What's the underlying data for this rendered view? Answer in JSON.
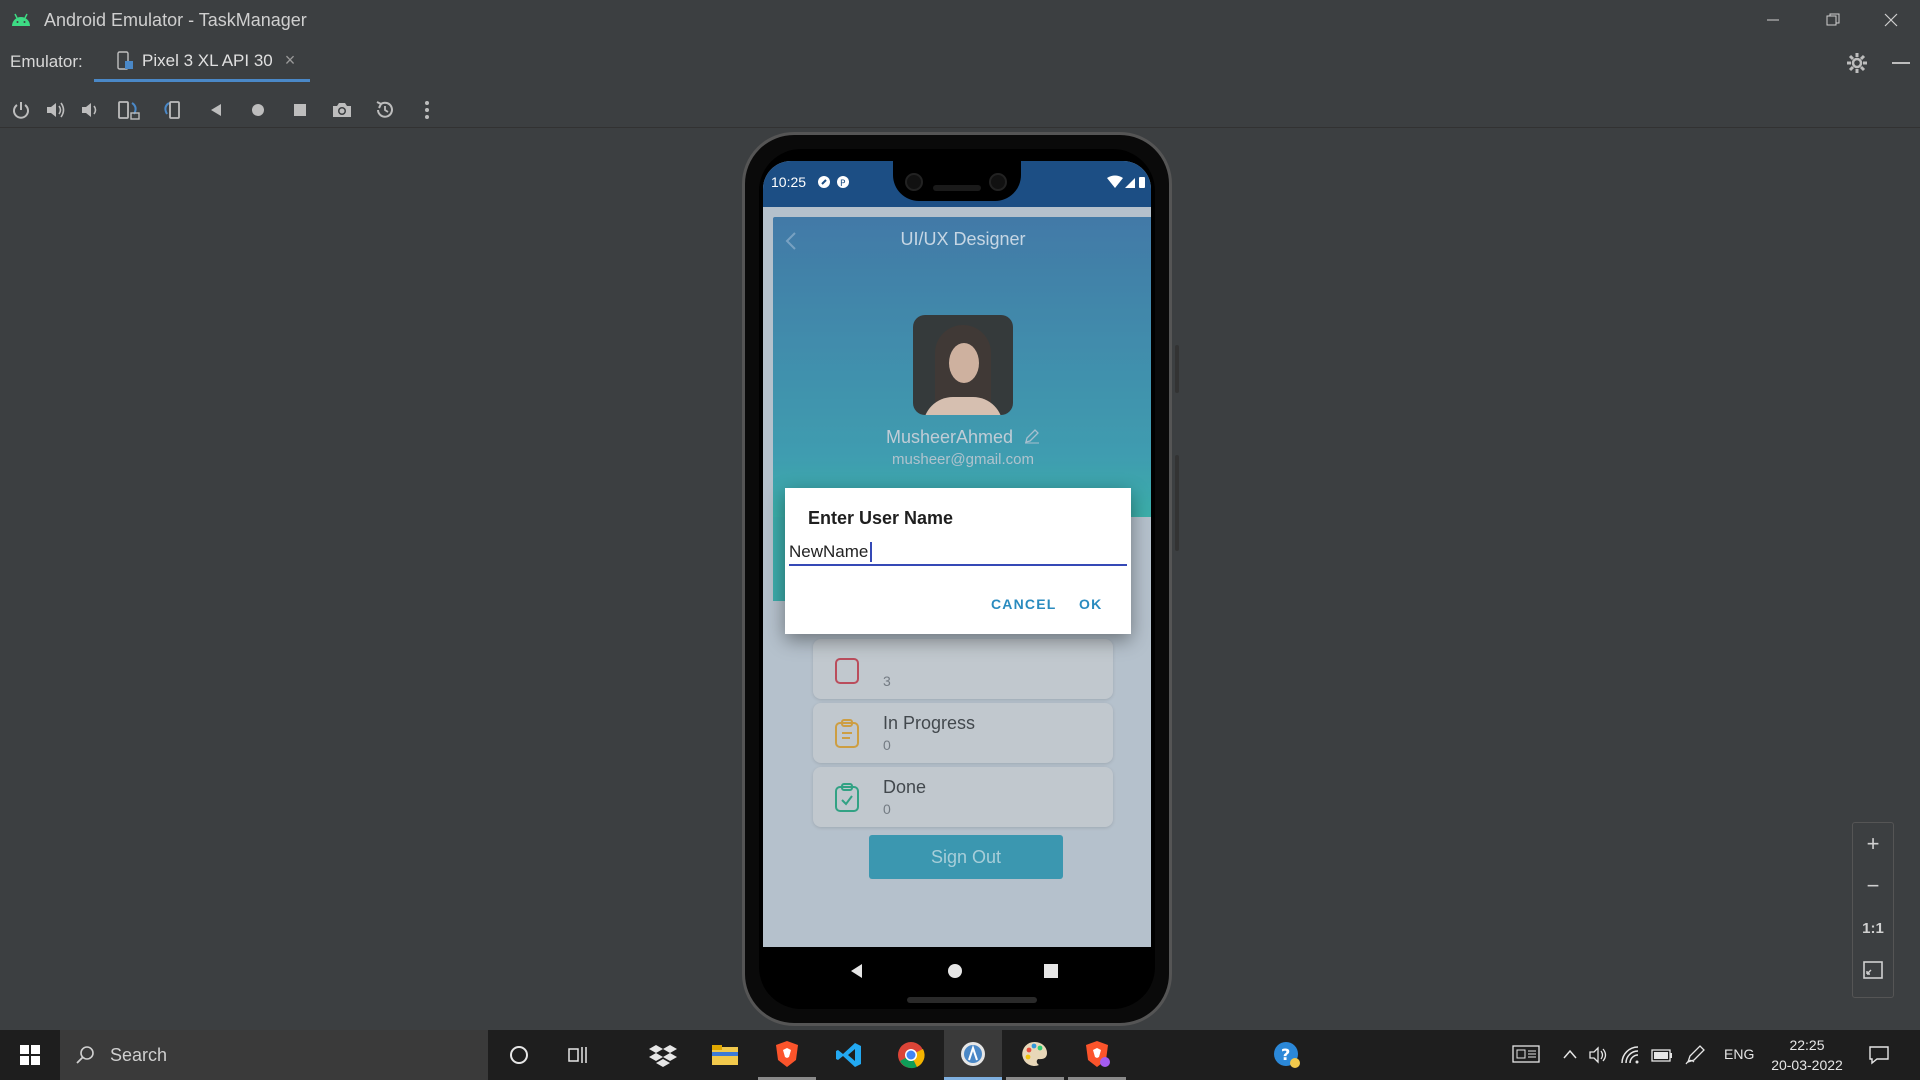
{
  "window": {
    "title": "Android Emulator - TaskManager",
    "controls": [
      "minimize",
      "restore",
      "close"
    ]
  },
  "emulator": {
    "label": "Emulator:",
    "device_tab": "Pixel 3 XL API 30",
    "tab_close": "×"
  },
  "toolbar": {
    "buttons": [
      "power-icon",
      "volume-up-icon",
      "volume-down-icon",
      "rotate-left-icon",
      "rotate-right-icon",
      "back-icon",
      "home-icon",
      "overview-icon",
      "camera-icon",
      "snapshot-icon",
      "more-icon"
    ]
  },
  "phone": {
    "status_time": "10:25",
    "app": {
      "header_title": "UI/UX Designer",
      "user_name": "MusheerAhmed",
      "user_email": "musheer@gmail.com",
      "tasks": [
        {
          "label": "",
          "count": "3",
          "color": "#c0394a"
        },
        {
          "label": "In Progress",
          "count": "0",
          "color": "#d79b2a"
        },
        {
          "label": "Done",
          "count": "0",
          "color": "#1aa07a"
        }
      ],
      "signout_label": "Sign Out"
    },
    "dialog": {
      "title": "Enter User Name",
      "input_value": "NewName",
      "cancel_label": "CANCEL",
      "ok_label": "OK"
    }
  },
  "zoom": {
    "zoom_in": "+",
    "zoom_out": "−",
    "one_to_one": "1:1"
  },
  "taskbar": {
    "search_label": "Search",
    "language": "ENG",
    "time": "22:25",
    "date": "20-03-2022"
  },
  "colors": {
    "accent": "#4a88c7",
    "dialog_button": "#2a8bbf",
    "input_underline": "#3549b6"
  }
}
